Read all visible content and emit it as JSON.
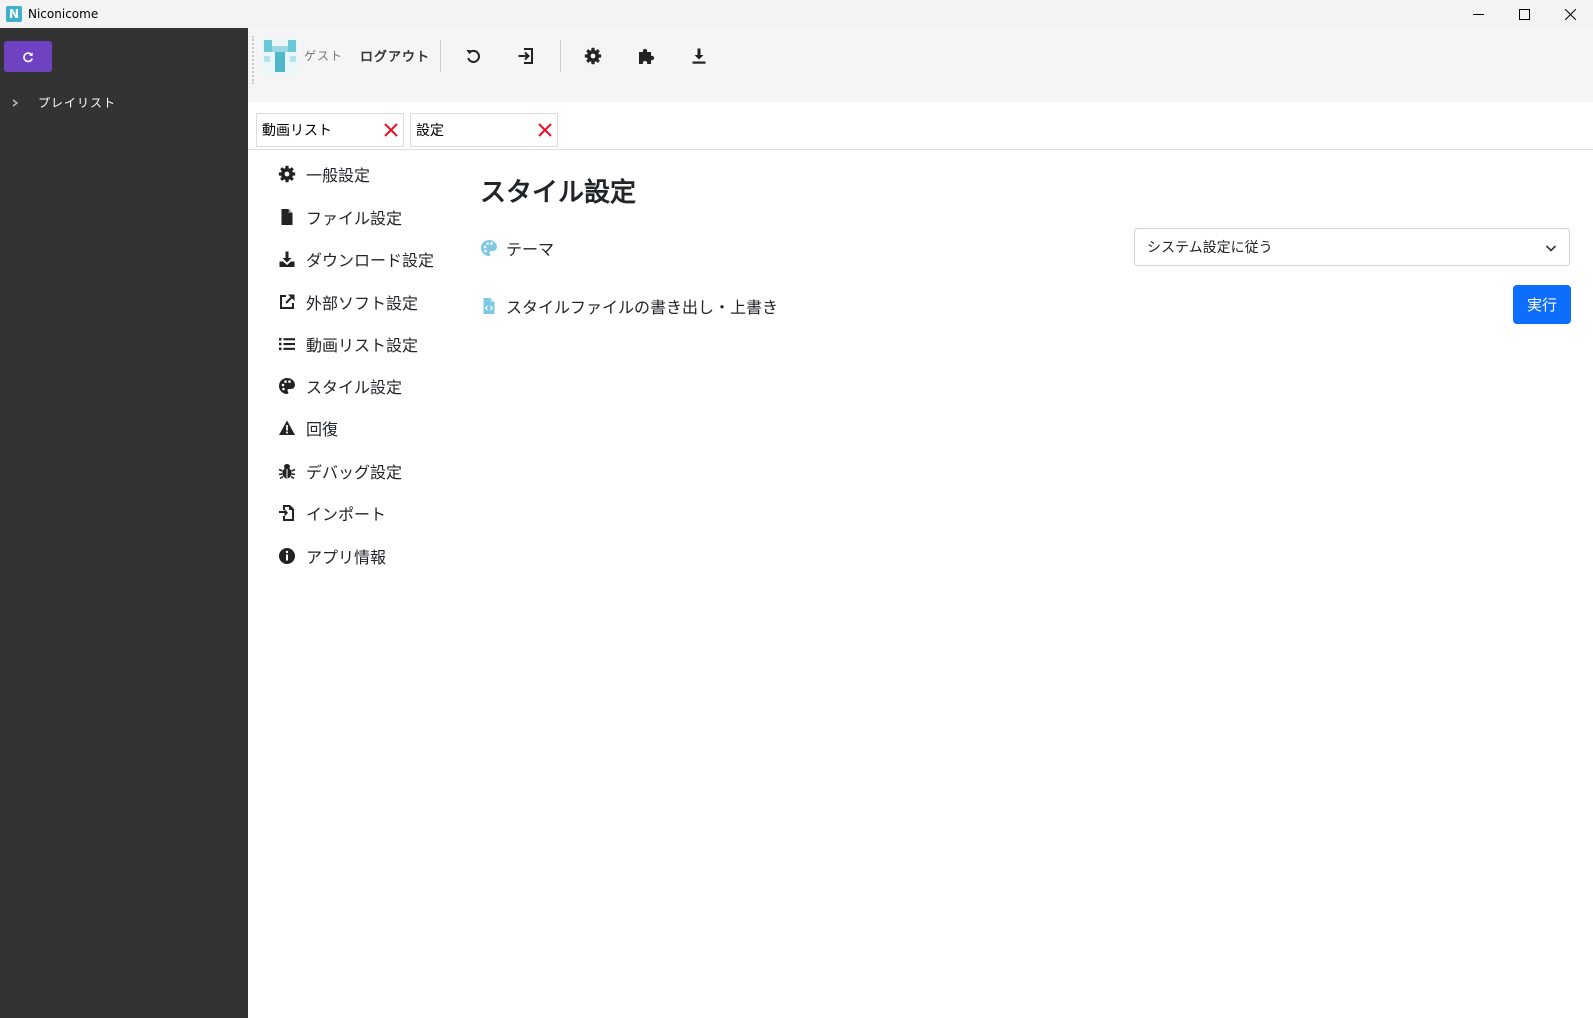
{
  "window": {
    "title": "Niconicome",
    "logo_letter": "N"
  },
  "sidebar": {
    "tree_items": [
      {
        "label": "プレイリスト"
      }
    ]
  },
  "toolbar": {
    "user_name": "ゲスト",
    "logout_label": "ログアウト"
  },
  "tabs": [
    {
      "label": "動画リスト"
    },
    {
      "label": "設定"
    }
  ],
  "settings_nav": [
    {
      "label": "一般設定",
      "icon": "gear-icon"
    },
    {
      "label": "ファイル設定",
      "icon": "file-icon"
    },
    {
      "label": "ダウンロード設定",
      "icon": "download-icon"
    },
    {
      "label": "外部ソフト設定",
      "icon": "external-link-icon"
    },
    {
      "label": "動画リスト設定",
      "icon": "list-icon"
    },
    {
      "label": "スタイル設定",
      "icon": "palette-icon"
    },
    {
      "label": "回復",
      "icon": "warning-icon"
    },
    {
      "label": "デバッグ設定",
      "icon": "bug-icon"
    },
    {
      "label": "インポート",
      "icon": "import-icon"
    },
    {
      "label": "アプリ情報",
      "icon": "info-icon"
    }
  ],
  "content": {
    "title": "スタイル設定",
    "theme": {
      "label": "テーマ",
      "selected_value": "システム設定に従う"
    },
    "style_file": {
      "label": "スタイルファイルの書き出し・上書き",
      "button_label": "実行"
    }
  },
  "colors": {
    "sidebar_bg": "#333333",
    "refresh_button": "#6f42c1",
    "primary_button": "#0d6efd",
    "tab_close": "#e81123",
    "accent_icon": "#7ec8e3"
  }
}
